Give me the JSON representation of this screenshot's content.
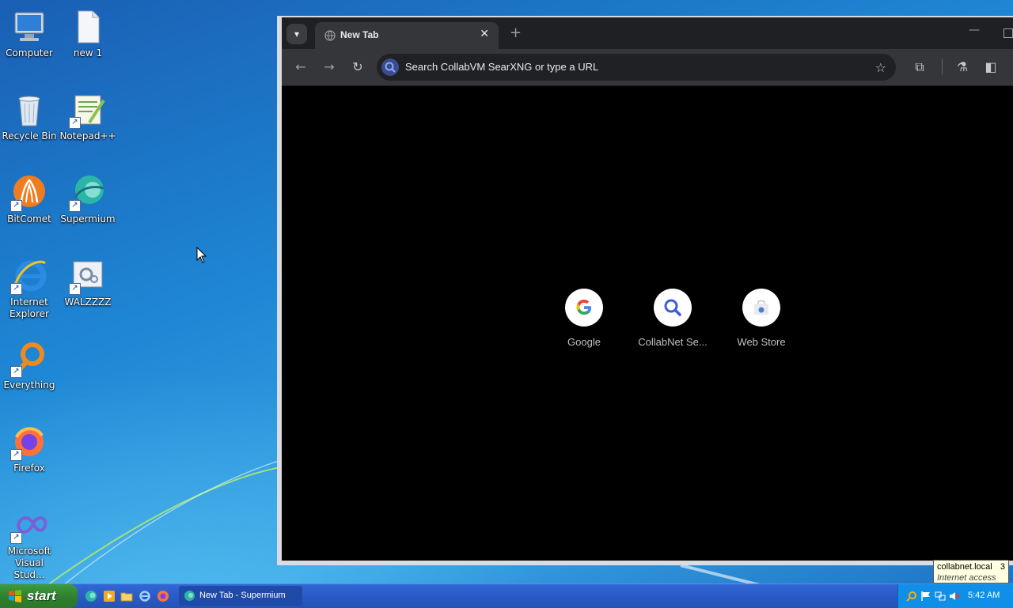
{
  "desktop": {
    "icons": [
      {
        "label": "Computer"
      },
      {
        "label": "new 1"
      },
      {
        "label": "Recycle Bin"
      },
      {
        "label": "Notepad++"
      },
      {
        "label": "BitComet"
      },
      {
        "label": "Supermium"
      },
      {
        "label": "Internet Explorer"
      },
      {
        "label": "WALZZZZ"
      },
      {
        "label": "Everything"
      },
      {
        "label": "Firefox"
      },
      {
        "label": "Microsoft Visual Stud..."
      }
    ]
  },
  "browser": {
    "tab_title": "New Tab",
    "omnibox_placeholder": "Search CollabVM SearXNG or type a URL",
    "shortcuts": [
      {
        "label": "Google",
        "icon": "google-icon"
      },
      {
        "label": "CollabNet Se...",
        "icon": "search-icon"
      },
      {
        "label": "Web Store",
        "icon": "web-store-icon"
      }
    ]
  },
  "taskbar": {
    "start_label": "start",
    "task_label": "New Tab - Supermium",
    "clock": "5:42 AM"
  },
  "tooltip": {
    "network": "collabnet.local",
    "count": "3",
    "status": "Internet access"
  },
  "colors": {
    "taskbar": "#2a5bc7",
    "start": "#2e7d2e",
    "browser_chrome": "#35363a",
    "ntp_background": "#000000"
  }
}
